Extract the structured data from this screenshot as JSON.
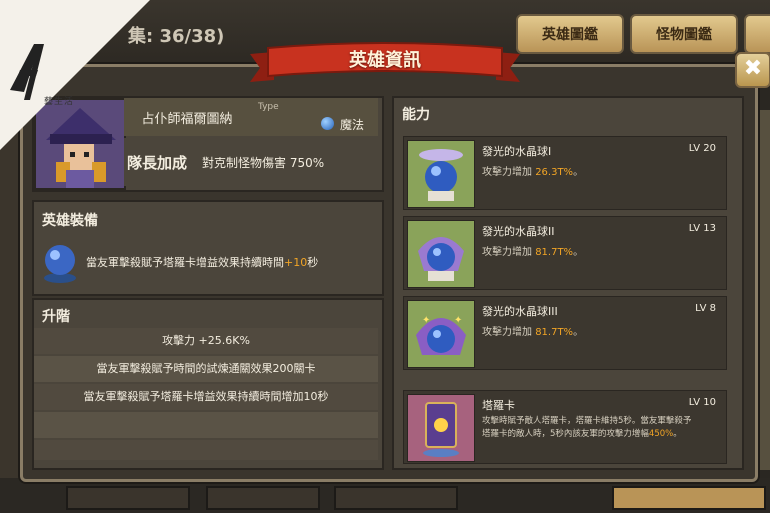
{
  "top_bar": {
    "collection_count": "集: 36/38)",
    "tabs": [
      {
        "label": "英雄圖鑑"
      },
      {
        "label": "怪物圖鑑"
      }
    ]
  },
  "watermark": {
    "brand": "藝生活"
  },
  "dialog": {
    "title": "英雄資訊",
    "close": "✖",
    "hero": {
      "name": "占仆師福爾圖納",
      "type_label": "Type",
      "type_value": "魔法",
      "bonus_label": "隊長加成",
      "bonus_value": "對克制怪物傷害 750%"
    },
    "equipment": {
      "heading": "英雄裝備",
      "text_before": "當友軍擊殺賦予塔羅卡增益效果持續時間",
      "text_highlight": "+10",
      "text_after": "秒"
    },
    "upgrade": {
      "heading": "升階",
      "rows": [
        "攻擊力 +25.6K%",
        "當友軍擊殺賦予時間的試煉通關效果200關卡",
        "當友軍擊殺賦予塔羅卡增益效果持續時間增加10秒",
        "",
        ""
      ]
    },
    "abilities": {
      "heading": "能力",
      "items": [
        {
          "name": "發光的水晶球I",
          "level": "LV 20",
          "desc": "攻擊力增加 ",
          "value": "26.3T%",
          "suffix": "。"
        },
        {
          "name": "發光的水晶球II",
          "level": "LV 13",
          "desc": "攻擊力增加 ",
          "value": "81.7T%",
          "suffix": "。"
        },
        {
          "name": "發光的水晶球III",
          "level": "LV 8",
          "desc": "攻擊力增加 ",
          "value": "81.7T%",
          "suffix": "。"
        },
        {
          "name": "塔羅卡",
          "level": "LV 10",
          "desc_line1": "攻擊時賦予敵人塔羅卡，塔羅卡維持5秒。當友軍擊殺予",
          "desc_line2": "塔羅卡的敵人時，5秒內該友軍的攻擊力增幅",
          "value": "450%",
          "suffix": "。"
        }
      ]
    }
  },
  "colors": {
    "accent": "#f2a526",
    "ribbon": "#c8321f",
    "panel": "#4b453b"
  }
}
